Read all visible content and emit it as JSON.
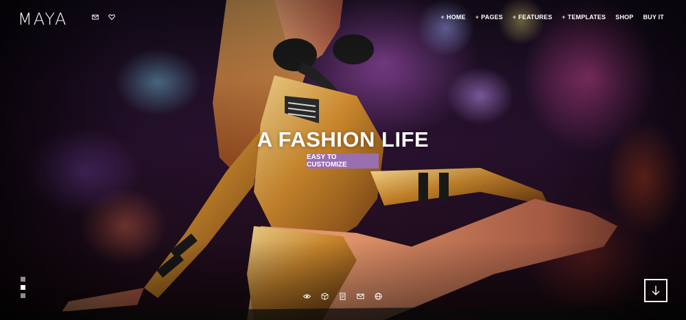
{
  "brand": {
    "logo": "MAYA"
  },
  "header_icons": [
    "envelope-icon",
    "heart-icon"
  ],
  "nav": [
    {
      "label": "HOME",
      "has_plus": true
    },
    {
      "label": "PAGES",
      "has_plus": true
    },
    {
      "label": "FEATURES",
      "has_plus": true
    },
    {
      "label": "TEMPLATES",
      "has_plus": true
    },
    {
      "label": "SHOP",
      "has_plus": false
    },
    {
      "label": "BUY IT",
      "has_plus": false
    }
  ],
  "hero": {
    "headline": "A FASHION LIFE",
    "badge": "EASY TO CUSTOMIZE",
    "badge_color": "#9a6fb0"
  },
  "slider": {
    "count": 3,
    "active_index": 1
  },
  "social_icons": [
    "eye-icon",
    "cube-icon",
    "document-icon",
    "envelope-icon",
    "globe-icon"
  ],
  "scroll_button": {
    "icon": "arrow-down-icon"
  }
}
